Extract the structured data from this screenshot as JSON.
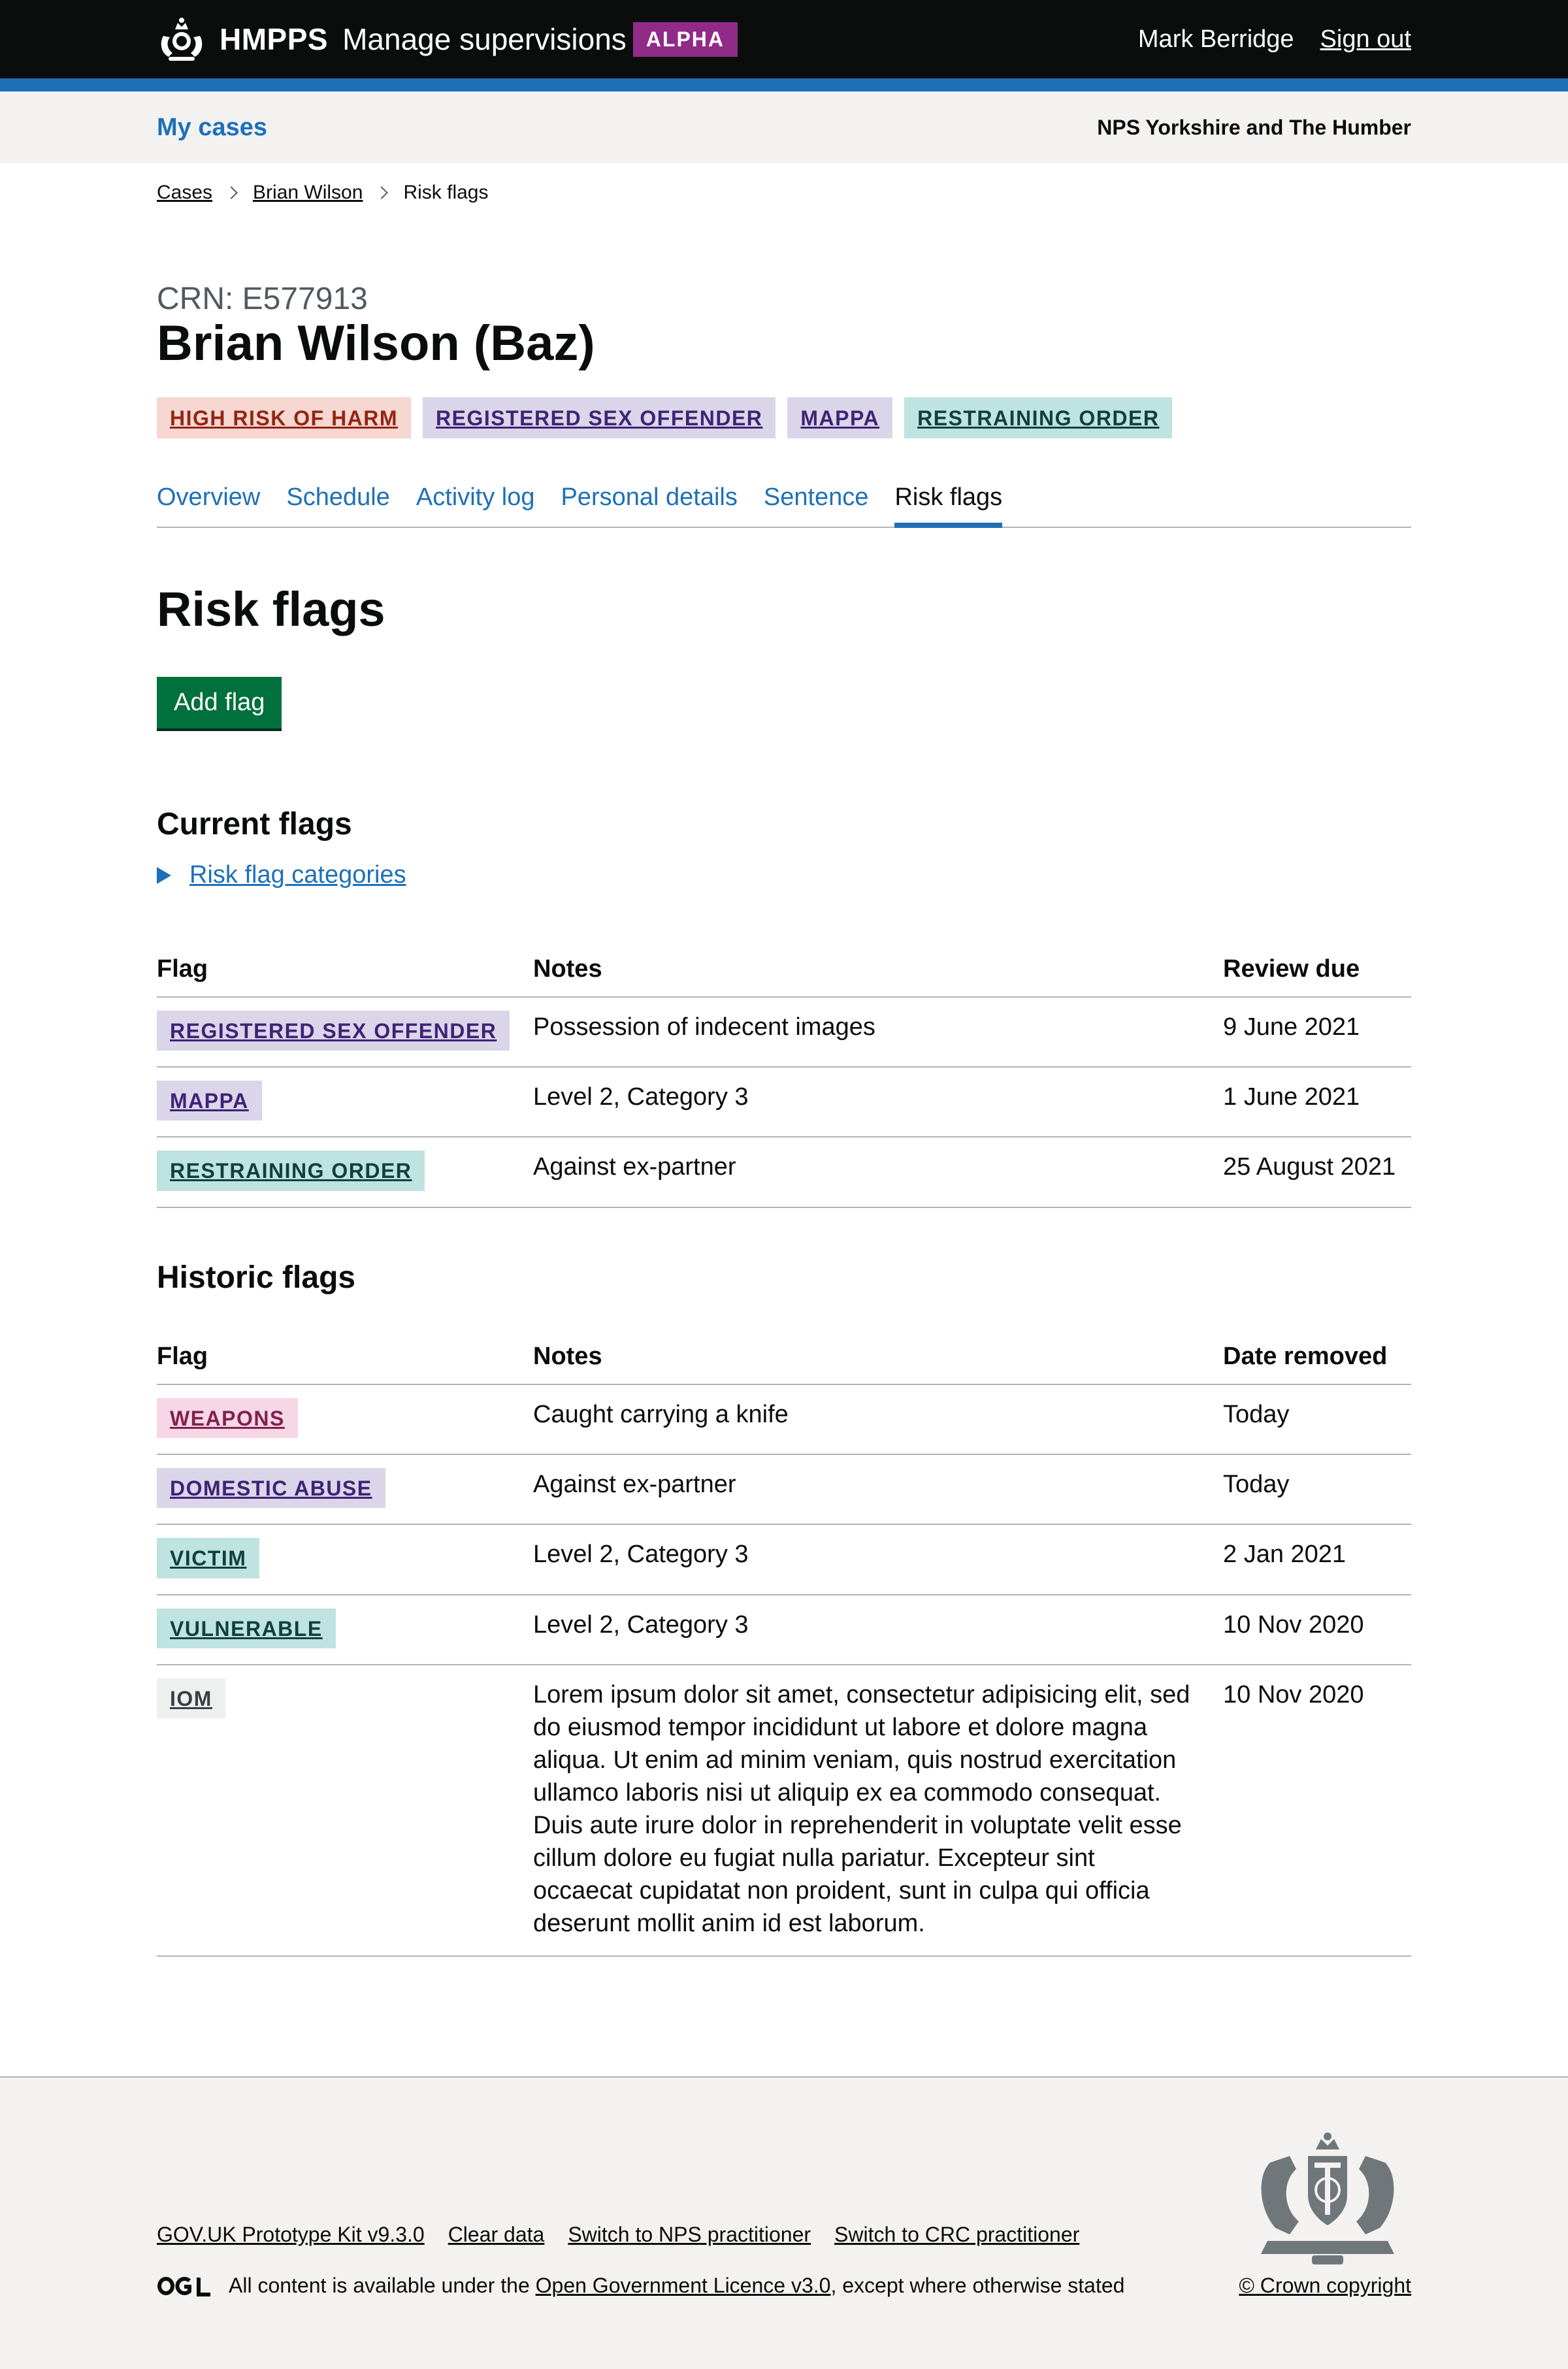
{
  "header": {
    "brand": "HMPPS",
    "service_name": "Manage supervisions",
    "phase": "ALPHA",
    "user_name": "Mark Berridge",
    "sign_out": "Sign out"
  },
  "subnav": {
    "my_cases": "My cases",
    "region": "NPS Yorkshire and The Humber"
  },
  "breadcrumb": [
    "Cases",
    "Brian Wilson",
    "Risk flags"
  ],
  "case": {
    "crn": "CRN: E577913",
    "name": "Brian Wilson (Baz)",
    "tags": [
      {
        "label": "HIGH RISK OF HARM",
        "color": "red"
      },
      {
        "label": "REGISTERED SEX OFFENDER",
        "color": "purple"
      },
      {
        "label": "MAPPA",
        "color": "purple"
      },
      {
        "label": "RESTRAINING ORDER",
        "color": "turquoise"
      }
    ]
  },
  "tabs": [
    {
      "label": "Overview",
      "active": false
    },
    {
      "label": "Schedule",
      "active": false
    },
    {
      "label": "Activity log",
      "active": false
    },
    {
      "label": "Personal details",
      "active": false
    },
    {
      "label": "Sentence",
      "active": false
    },
    {
      "label": "Risk flags",
      "active": true
    }
  ],
  "page_title": "Risk flags",
  "add_flag_button": "Add flag",
  "current_flags": {
    "heading": "Current flags",
    "details_summary": "Risk flag categories",
    "columns": [
      "Flag",
      "Notes",
      "Review due"
    ],
    "rows": [
      {
        "flag": "REGISTERED SEX OFFENDER",
        "color": "purple",
        "notes": "Possession of indecent images",
        "date": "9 June 2021"
      },
      {
        "flag": "MAPPA",
        "color": "purple",
        "notes": "Level 2, Category 3",
        "date": "1 June 2021"
      },
      {
        "flag": "RESTRAINING ORDER",
        "color": "turquoise",
        "notes": "Against ex-partner",
        "date": "25 August 2021"
      }
    ]
  },
  "historic_flags": {
    "heading": "Historic flags",
    "columns": [
      "Flag",
      "Notes",
      "Date removed"
    ],
    "rows": [
      {
        "flag": "WEAPONS",
        "color": "pink",
        "notes": "Caught carrying a knife",
        "date": "Today"
      },
      {
        "flag": "DOMESTIC ABUSE",
        "color": "purple",
        "notes": "Against ex-partner",
        "date": "Today"
      },
      {
        "flag": "VICTIM",
        "color": "turquoise",
        "notes": "Level 2, Category 3",
        "date": "2 Jan 2021"
      },
      {
        "flag": "VULNERABLE",
        "color": "turquoise",
        "notes": "Level 2, Category 3",
        "date": "10 Nov 2020"
      },
      {
        "flag": "IOM",
        "color": "grey",
        "notes": "Lorem ipsum dolor sit amet, consectetur adipisicing elit, sed do eiusmod tempor incididunt ut labore et dolore magna aliqua. Ut enim ad minim veniam, quis nostrud exercitation ullamco laboris nisi ut aliquip ex ea commodo consequat. Duis aute irure dolor in reprehenderit in voluptate velit esse cillum dolore eu fugiat nulla pariatur. Excepteur sint occaecat cupidatat non proident, sunt in culpa qui officia deserunt mollit anim id est laborum.",
        "date": "10 Nov 2020"
      }
    ]
  },
  "footer": {
    "links": [
      "GOV.UK Prototype Kit v9.3.0",
      "Clear data",
      "Switch to NPS practitioner",
      "Switch to CRC practitioner"
    ],
    "licence_prefix": "All content is available under the",
    "licence_link": "Open Government Licence v3.0",
    "licence_suffix": ", except where otherwise stated",
    "copyright": "© Crown copyright"
  },
  "colors": {
    "header_bg": "#0b0c0c",
    "accent_blue": "#1d70b8",
    "phase_purple": "#912b88",
    "button_green": "#00703c",
    "footer_bg": "#f3f2f1"
  }
}
